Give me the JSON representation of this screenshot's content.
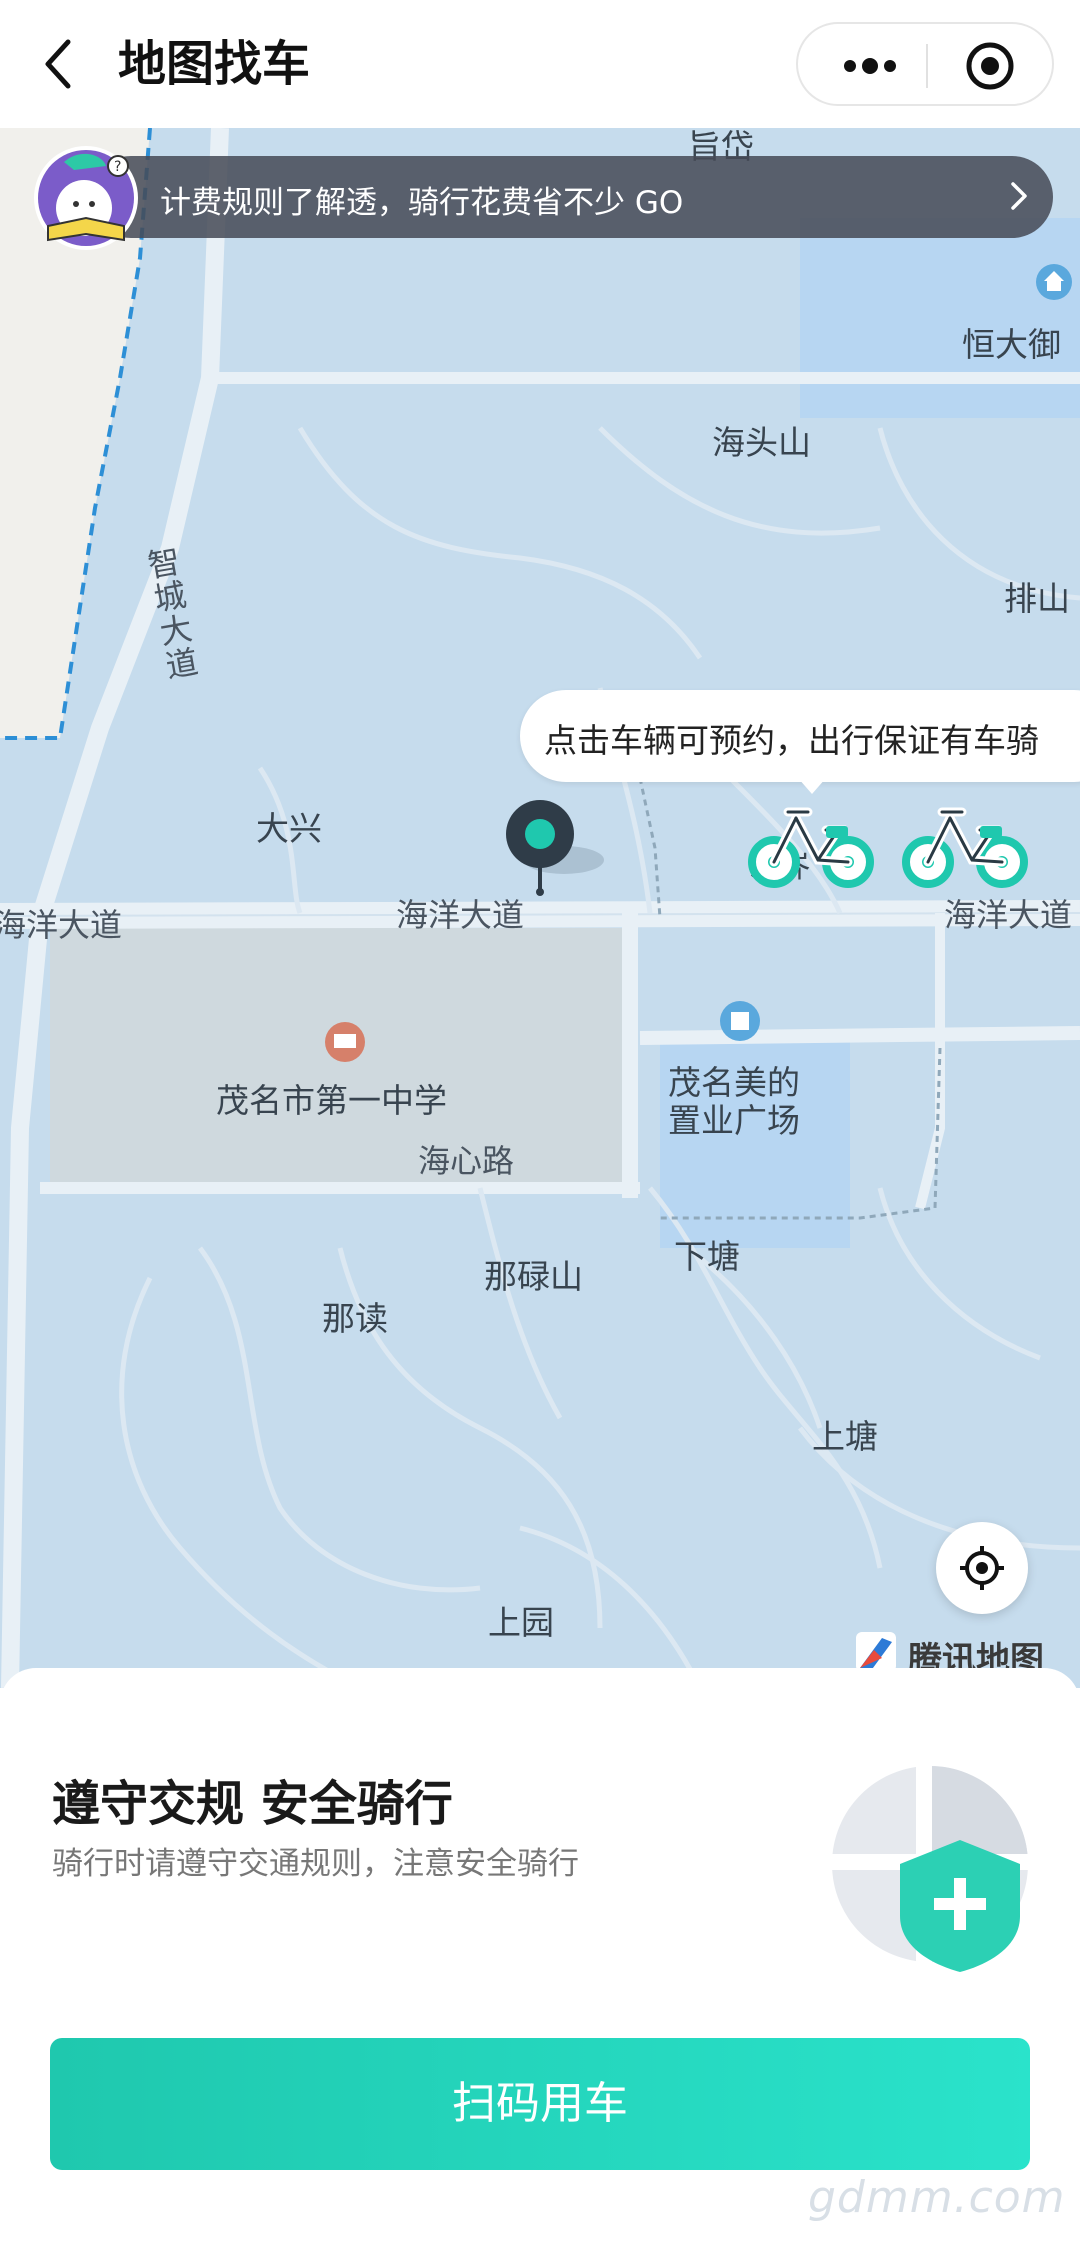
{
  "header": {
    "title": "地图找车",
    "icons": {
      "back": "chevron-left-icon",
      "more": "more-dots-icon",
      "close": "target-circle-icon"
    }
  },
  "notice": {
    "text": "计费规则了解透，骑行花费省不少 GO",
    "icons": {
      "mascot": "mascot-reading-icon",
      "arrow": "chevron-right-icon"
    }
  },
  "map": {
    "labels": {
      "top_cut": "旨岱",
      "hengda": "恒大御",
      "haitoushan": "海头山",
      "paishan": "排山",
      "daxing": "大兴",
      "haiyang_left": "海洋大道",
      "haiyang_mid": "海洋大道",
      "haiyang_right": "海洋大道",
      "school": "茂名市第一中学",
      "plaza_line1": "茂名美的",
      "plaza_line2": "置业广场",
      "haixinlu": "海心路",
      "xiatang": "下塘",
      "naluoshan": "那碌山",
      "nadu": "那读",
      "shangtang": "上塘",
      "shangyuan": "上园",
      "zhicheng": "智城大道",
      "village_behind_bike": "鸡岕"
    },
    "tooltip": "点击车辆可预约，出行保证有车骑",
    "brand": "腾讯地图",
    "colors": {
      "water": "#c6dced",
      "land": "#f0efeb",
      "road": "#e8f0f6",
      "accent": "#1fc8ae"
    },
    "icons": {
      "locate": "locate-crosshair-icon",
      "pin": "map-pin-icon",
      "bike": "bike-icon",
      "school": "school-poi-icon",
      "building": "building-poi-icon",
      "home": "home-poi-icon"
    }
  },
  "sheet": {
    "title": "遵守交规 安全骑行",
    "subtitle": "骑行时请遵守交通规则，注意安全骑行",
    "button": "扫码用车",
    "illustration": "shield-plus-icon"
  },
  "watermark": "gdmm.com"
}
